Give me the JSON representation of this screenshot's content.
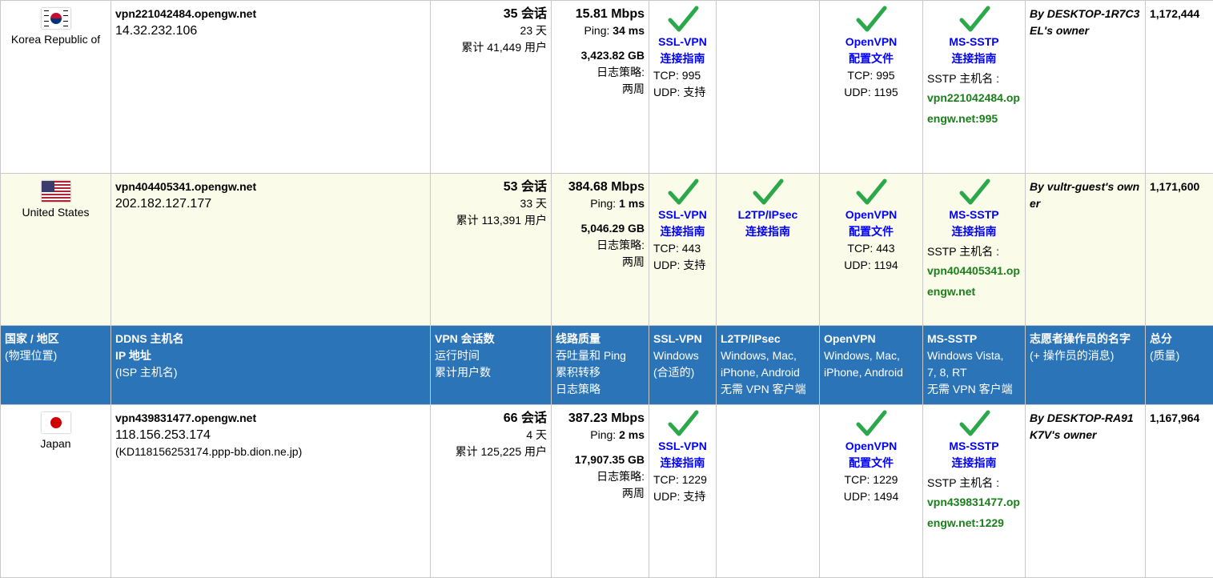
{
  "rows": [
    {
      "country": "Korea Republic of",
      "flag": "kr-flag-icon",
      "ddns": "vpn221042484.opengw.net",
      "ip": "14.32.232.106",
      "isp": "",
      "sessions": "35 会话",
      "uptime": "23 天",
      "total_users": "累计 41,449 用户",
      "speed": "15.81 Mbps",
      "ping_label": "Ping: ",
      "ping_value": "34 ms",
      "transfer": "3,423.82 GB",
      "log_label": "日志策略:",
      "log_value": "两周",
      "sslvpn": {
        "name": "SSL-VPN",
        "guide": "连接指南",
        "tcp": "TCP: 995",
        "udp": "UDP: 支持"
      },
      "l2tp": null,
      "openvpn": {
        "name": "OpenVPN",
        "config": "配置文件",
        "tcp": "TCP: 995",
        "udp": "UDP: 1195"
      },
      "sstp": {
        "name": "MS-SSTP",
        "guide": "连接指南",
        "host_label": "SSTP 主机名 :",
        "host": "vpn221042484.opengw.net:995"
      },
      "owner": "By DESKTOP-1R7C3EL's owner",
      "score": "1,172,444"
    },
    {
      "country": "United States",
      "flag": "us-flag-icon",
      "ddns": "vpn404405341.opengw.net",
      "ip": "202.182.127.177",
      "isp": "",
      "sessions": "53 会话",
      "uptime": "33 天",
      "total_users": "累计 113,391 用户",
      "speed": "384.68 Mbps",
      "ping_label": "Ping: ",
      "ping_value": "1 ms",
      "transfer": "5,046.29 GB",
      "log_label": "日志策略:",
      "log_value": "两周",
      "sslvpn": {
        "name": "SSL-VPN",
        "guide": "连接指南",
        "tcp": "TCP: 443",
        "udp": "UDP: 支持"
      },
      "l2tp": {
        "name": "L2TP/IPsec",
        "guide": "连接指南"
      },
      "openvpn": {
        "name": "OpenVPN",
        "config": "配置文件",
        "tcp": "TCP: 443",
        "udp": "UDP: 1194"
      },
      "sstp": {
        "name": "MS-SSTP",
        "guide": "连接指南",
        "host_label": "SSTP 主机名 :",
        "host": "vpn404405341.opengw.net"
      },
      "owner": "By vultr-guest's owner",
      "score": "1,171,600"
    },
    {
      "country": "Japan",
      "flag": "jp-flag-icon",
      "ddns": "vpn439831477.opengw.net",
      "ip": "118.156.253.174",
      "isp": "(KD118156253174.ppp-bb.dion.ne.jp)",
      "sessions": "66 会话",
      "uptime": "4 天",
      "total_users": "累计 125,225 用户",
      "speed": "387.23 Mbps",
      "ping_label": "Ping: ",
      "ping_value": "2 ms",
      "transfer": "17,907.35 GB",
      "log_label": "日志策略:",
      "log_value": "两周",
      "sslvpn": {
        "name": "SSL-VPN",
        "guide": "连接指南",
        "tcp": "TCP: 1229",
        "udp": "UDP: 支持"
      },
      "l2tp": null,
      "openvpn": {
        "name": "OpenVPN",
        "config": "配置文件",
        "tcp": "TCP: 1229",
        "udp": "UDP: 1494"
      },
      "sstp": {
        "name": "MS-SSTP",
        "guide": "连接指南",
        "host_label": "SSTP 主机名 :",
        "host": "vpn439831477.opengw.net:1229"
      },
      "owner": "By DESKTOP-RA91K7V's owner",
      "score": "1,167,964"
    }
  ],
  "header": {
    "country": [
      "国家 / 地区",
      "(物理位置)"
    ],
    "ddns": [
      "DDNS 主机名",
      "IP 地址",
      "(ISP 主机名)"
    ],
    "sessions": [
      "VPN 会话数",
      "运行时间",
      "累计用户数"
    ],
    "quality": [
      "线路质量",
      "吞吐量和 Ping",
      "累积转移",
      "日志策略"
    ],
    "sslvpn": [
      "SSL-VPN",
      "Windows",
      "(合适的)"
    ],
    "l2tp": [
      "L2TP/IPsec",
      "Windows, Mac,",
      "iPhone, Android",
      "无需 VPN 客户端"
    ],
    "openvpn": [
      "OpenVPN",
      "Windows, Mac,",
      "iPhone, Android"
    ],
    "sstp": [
      "MS-SSTP",
      "Windows Vista,",
      "7, 8, RT",
      "无需 VPN 客户端"
    ],
    "owner": [
      "志愿者操作员的名字",
      "(+ 操作员的消息)"
    ],
    "score": [
      "总分",
      "(质量)"
    ]
  },
  "colors": {
    "header_bg": "#2b74b7",
    "link": "#0000ff",
    "host": "#1a7f1a",
    "check": "#2aa84a",
    "alt_row": "#fbfbea"
  }
}
